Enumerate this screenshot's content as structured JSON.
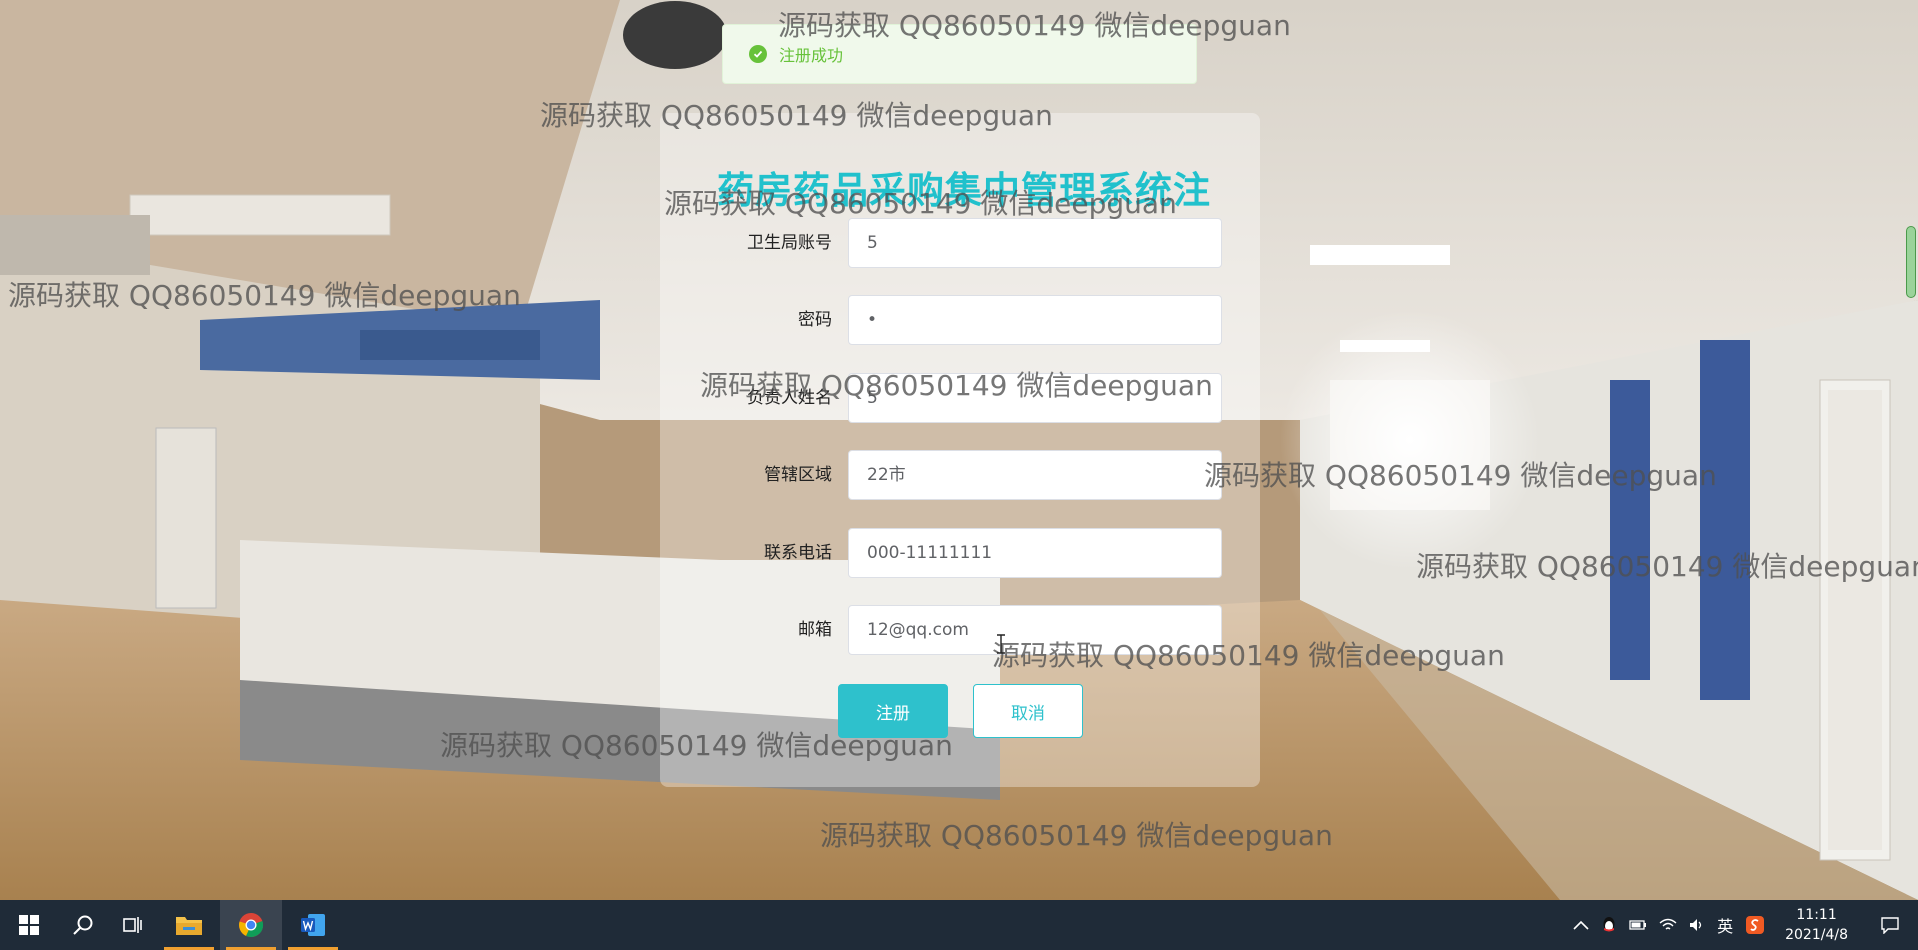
{
  "toast": {
    "message": "注册成功",
    "icon": "check-circle-icon",
    "color": "#67c23a"
  },
  "form": {
    "title": "药房药品采购集中管理系统注册",
    "fields": [
      {
        "label": "卫生局账号",
        "value": "5"
      },
      {
        "label": "密码",
        "value": "•"
      },
      {
        "label": "负责人姓名",
        "value": "5"
      },
      {
        "label": "管辖区域",
        "value": "22市"
      },
      {
        "label": "联系电话",
        "value": "000-11111111"
      },
      {
        "label": "邮箱",
        "value": "12@qq.com"
      }
    ],
    "submit_label": "注册",
    "cancel_label": "取消",
    "accent": "#2ec1cc"
  },
  "watermark": {
    "text": "源码获取 QQ86050149 微信deepguan"
  },
  "taskbar": {
    "apps": [
      "windows-start-icon",
      "search-icon",
      "task-view-icon",
      "file-explorer-icon",
      "chrome-icon",
      "word-icon"
    ],
    "tray": {
      "ime_label": "英",
      "time": "11:11",
      "date": "2021/4/8"
    }
  }
}
